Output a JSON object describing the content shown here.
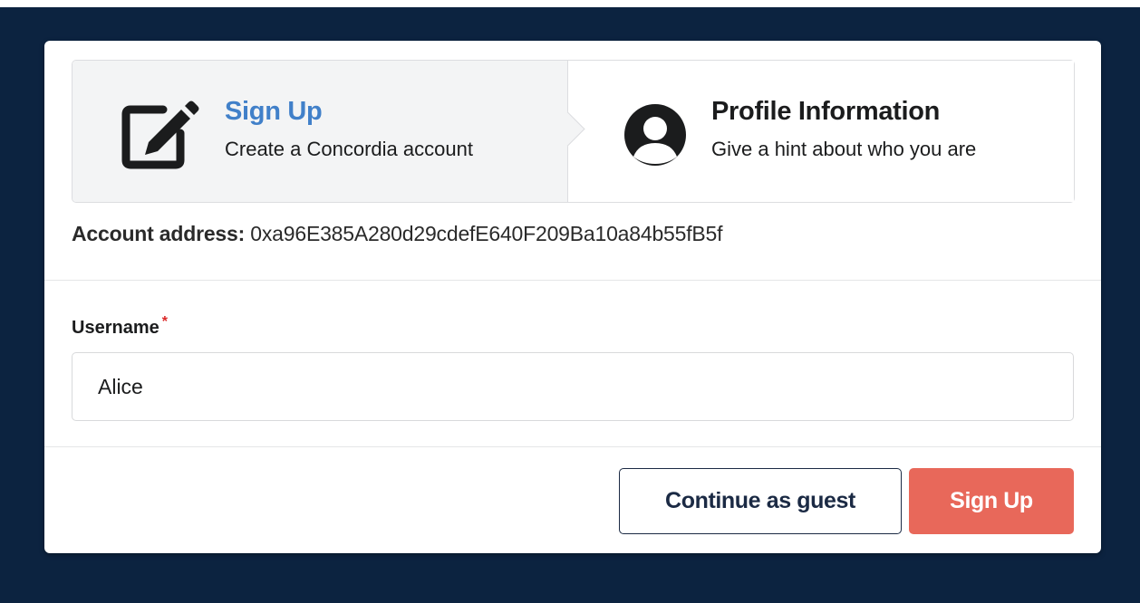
{
  "steps": [
    {
      "title": "Sign Up",
      "description": "Create a Concordia account",
      "icon": "edit-icon",
      "state": "active"
    },
    {
      "title": "Profile Information",
      "description": "Give a hint about who you are",
      "icon": "user-circle-icon",
      "state": "pending"
    }
  ],
  "account": {
    "label": "Account address:",
    "value": "0xa96E385A280d29cdefE640F209Ba10a84b55fB5f"
  },
  "form": {
    "username_label": "Username",
    "required_marker": "*",
    "username_value": "Alice"
  },
  "actions": {
    "guest_label": "Continue as guest",
    "signup_label": "Sign Up"
  },
  "colors": {
    "background": "#0c2340",
    "active_step_title": "#4180c9",
    "primary_button": "#e8685a",
    "required": "#db2828"
  }
}
